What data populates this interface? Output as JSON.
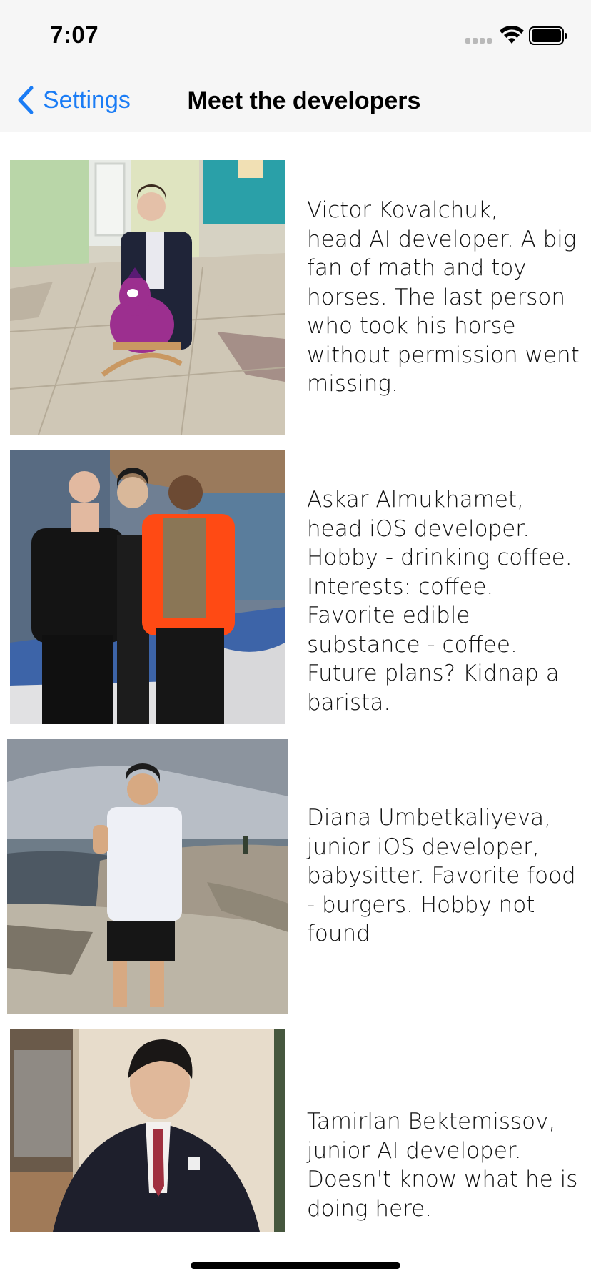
{
  "status_bar": {
    "time": "7:07",
    "icons": [
      "cellular-signal-icon",
      "wifi-icon",
      "battery-icon"
    ]
  },
  "nav": {
    "back_label": "Settings",
    "title": "Meet the developers"
  },
  "developers": [
    {
      "photo": "developer-photo-kid-on-toy-horse",
      "description": "Victor Kovalchuk,\nhead AI developer. A big fan of math and toy horses. The last person who took his horse without permission went missing."
    },
    {
      "photo": "developer-photo-group-at-building",
      "description": "Askar Almukhamet,\nhead iOS developer. Hobby - drinking coffee. Interests: coffee. Favorite edible substance - coffee. Future plans? Kidnap a barista."
    },
    {
      "photo": "developer-photo-seaside-rocks",
      "description": "Diana Umbetkaliyeva,\njunior iOS developer, babysitter. Favorite food - burgers. Hobby not found"
    },
    {
      "photo": "developer-photo-suit-portrait",
      "description": "Tamirlan Bektemissov,\njunior AI developer. Doesn't know what he is doing here."
    }
  ],
  "colors": {
    "accent": "#1a7cf5",
    "bar_background": "#f6f6f6"
  }
}
